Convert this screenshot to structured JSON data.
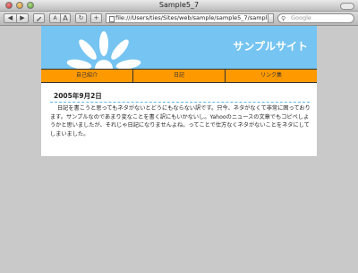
{
  "window": {
    "title": "Sample5_7"
  },
  "toolbar": {
    "back_icon": "◀",
    "forward_icon": "▶",
    "text_smaller": "A",
    "text_larger": "A",
    "reload_icon": "↻",
    "add_icon": "+",
    "address": "file:///Users/ties/Sites/web/sample/sample5_7/sample",
    "search_placeholder": "Google"
  },
  "site": {
    "title": "サンプルサイト",
    "nav": [
      "自己紹介",
      "日記",
      "リンク集"
    ],
    "post": {
      "date": "2005年9月2日",
      "body": "日記を書こうと思ってもネタがないとどうにもならない訳です。只今、ネタがなくて非常に困っております。サンプルなのであまり変なことを書く訳にもいかないし。Yahooのニュースの文章でもコピペしようかと思いましたが、それじゃ日記になりませんよね。ってことで仕方なくネタがないことをネタにしてしまいました。"
    }
  },
  "colors": {
    "header_bg": "#75c4f2",
    "nav_bg": "#ff9900",
    "desktop_bg": "#c9c9c9"
  }
}
